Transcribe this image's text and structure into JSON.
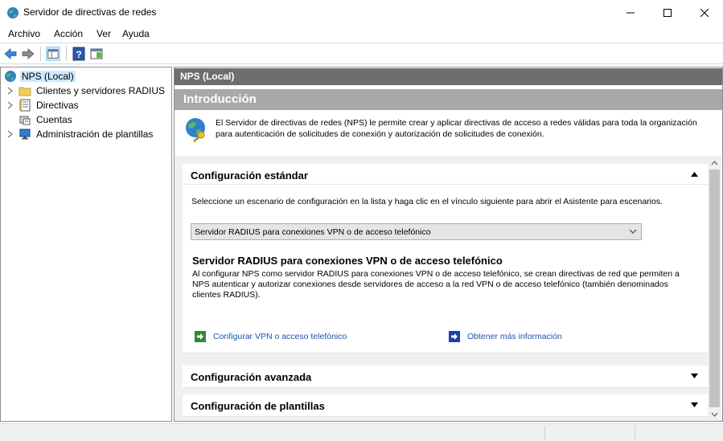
{
  "window": {
    "title": "Servidor de directivas de redes",
    "icon": "nps-globe-icon"
  },
  "menu": [
    "Archivo",
    "Acción",
    "Ver",
    "Ayuda"
  ],
  "toolbar": {
    "buttons": [
      "back-arrow-icon",
      "forward-arrow-icon",
      "show-hide-console-tree-icon",
      "help-icon",
      "show-action-pane-icon"
    ]
  },
  "tree": {
    "items": [
      {
        "label": "NPS (Local)",
        "icon": "nps-globe-icon",
        "selected": true,
        "expandable": false
      },
      {
        "label": "Clientes y servidores RADIUS",
        "icon": "folder-icon",
        "expandable": true
      },
      {
        "label": "Directivas",
        "icon": "policy-document-icon",
        "expandable": true
      },
      {
        "label": "Cuentas",
        "icon": "accounting-icon",
        "expandable": false
      },
      {
        "label": "Administración de plantillas",
        "icon": "templates-computer-icon",
        "expandable": true
      }
    ]
  },
  "right": {
    "header": "NPS (Local)",
    "intro_title": "Introducción",
    "intro_text": "El Servidor de directivas de redes (NPS) le permite crear y aplicar directivas de acceso a redes válidas para toda la organización para autenticación de solicitudes de conexión y autorización de solicitudes de conexión.",
    "sections": {
      "standard": {
        "title": "Configuración estándar",
        "expanded": true,
        "description": "Seleccione un escenario de configuración en la lista y haga clic en el vínculo siguiente para abrir el Asistente para escenarios.",
        "selected_scenario": "Servidor RADIUS para conexiones VPN o de acceso telefónico",
        "scenario_title": "Servidor RADIUS para conexiones VPN o de acceso telefónico",
        "scenario_description": "Al configurar NPS como servidor RADIUS para conexiones VPN o de acceso telefónico, se crean directivas de red que permiten a NPS autenticar y autorizar conexiones desde servidores de acceso a la red VPN o de acceso telefónico (también denominados clientes RADIUS).",
        "link_configure": "Configurar VPN o acceso telefónico",
        "link_more_info": "Obtener más información"
      },
      "advanced": {
        "title": "Configuración avanzada",
        "expanded": false
      },
      "templates": {
        "title": "Configuración de plantillas",
        "expanded": false
      }
    }
  },
  "colors": {
    "header_bg": "#6e6e6e",
    "intro_bg": "#a8a8a8",
    "link": "#1a53b0",
    "selection": "#cce8ff"
  }
}
